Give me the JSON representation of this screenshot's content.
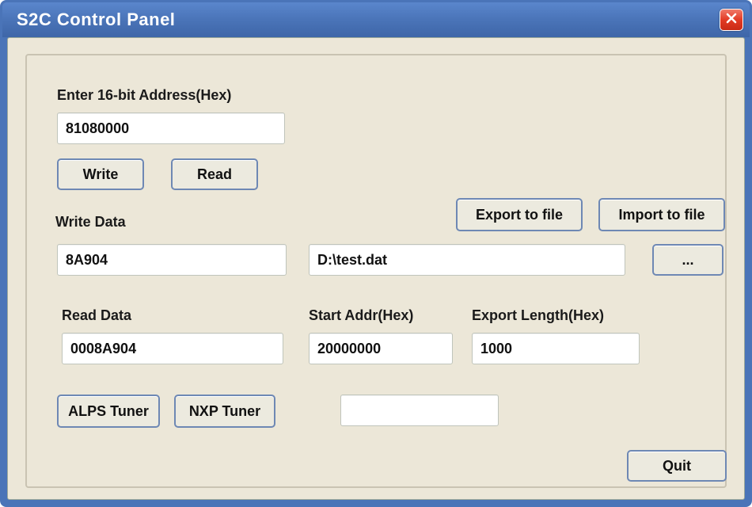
{
  "window": {
    "title": "S2C Control Panel"
  },
  "labels": {
    "address": "Enter 16-bit Address(Hex)",
    "writeData": "Write Data",
    "readData": "Read Data",
    "startAddr": "Start Addr(Hex)",
    "exportLength": "Export Length(Hex)"
  },
  "fields": {
    "address": "81080000",
    "writeData": "8A904",
    "readData": "0008A904",
    "filePath": "D:\\test.dat",
    "startAddr": "20000000",
    "exportLength": "1000",
    "tunerStatus": ""
  },
  "buttons": {
    "write": "Write",
    "read": "Read",
    "exportToFile": "Export to file",
    "importToFile": "Import to file",
    "browse": "...",
    "alpsTuner": "ALPS Tuner",
    "nxpTuner": "NXP Tuner",
    "quit": "Quit"
  }
}
